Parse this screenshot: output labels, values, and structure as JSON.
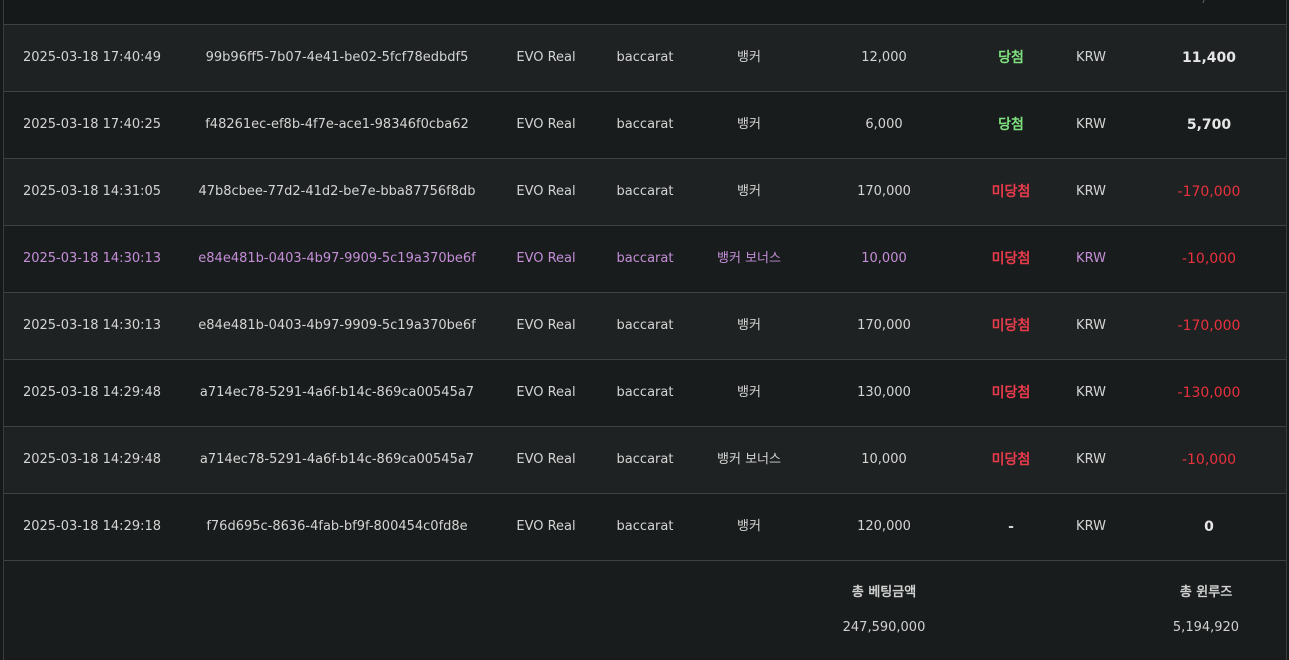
{
  "rows": [
    {
      "time": "2025-03-18 17:40:49",
      "id": "99b96ff5-7b07-4e41-be02-5fcf78edbdf5",
      "vendor": "EVO Real",
      "game": "baccarat",
      "pick": "뱅커",
      "amount": "12,000",
      "result": "당첨",
      "result_type": "win",
      "currency": "KRW",
      "winloss": "11,400",
      "winloss_type": "pos"
    },
    {
      "time": "2025-03-18 17:40:25",
      "id": "f48261ec-ef8b-4f7e-ace1-98346f0cba62",
      "vendor": "EVO Real",
      "game": "baccarat",
      "pick": "뱅커",
      "amount": "6,000",
      "result": "당첨",
      "result_type": "win",
      "currency": "KRW",
      "winloss": "5,700",
      "winloss_type": "pos"
    },
    {
      "time": "2025-03-18 14:31:05",
      "id": "47b8cbee-77d2-41d2-be7e-bba87756f8db",
      "vendor": "EVO Real",
      "game": "baccarat",
      "pick": "뱅커",
      "amount": "170,000",
      "result": "미당첨",
      "result_type": "lose",
      "currency": "KRW",
      "winloss": "-170,000",
      "winloss_type": "neg"
    },
    {
      "time": "2025-03-18 14:30:13",
      "id": "e84e481b-0403-4b97-9909-5c19a370be6f",
      "vendor": "EVO Real",
      "game": "baccarat",
      "pick": "뱅커 보너스",
      "amount": "10,000",
      "result": "미당첨",
      "result_type": "lose",
      "currency": "KRW",
      "winloss": "-10,000",
      "winloss_type": "neg",
      "highlight": true
    },
    {
      "time": "2025-03-18 14:30:13",
      "id": "e84e481b-0403-4b97-9909-5c19a370be6f",
      "vendor": "EVO Real",
      "game": "baccarat",
      "pick": "뱅커",
      "amount": "170,000",
      "result": "미당첨",
      "result_type": "lose",
      "currency": "KRW",
      "winloss": "-170,000",
      "winloss_type": "neg"
    },
    {
      "time": "2025-03-18 14:29:48",
      "id": "a714ec78-5291-4a6f-b14c-869ca00545a7",
      "vendor": "EVO Real",
      "game": "baccarat",
      "pick": "뱅커",
      "amount": "130,000",
      "result": "미당첨",
      "result_type": "lose",
      "currency": "KRW",
      "winloss": "-130,000",
      "winloss_type": "neg"
    },
    {
      "time": "2025-03-18 14:29:48",
      "id": "a714ec78-5291-4a6f-b14c-869ca00545a7",
      "vendor": "EVO Real",
      "game": "baccarat",
      "pick": "뱅커 보너스",
      "amount": "10,000",
      "result": "미당첨",
      "result_type": "lose",
      "currency": "KRW",
      "winloss": "-10,000",
      "winloss_type": "neg"
    },
    {
      "time": "2025-03-18 14:29:18",
      "id": "f76d695c-8636-4fab-bf9f-800454c0fd8e",
      "vendor": "EVO Real",
      "game": "baccarat",
      "pick": "뱅커",
      "amount": "120,000",
      "result": "-",
      "result_type": "neutral",
      "currency": "KRW",
      "winloss": "0",
      "winloss_type": "zero"
    }
  ],
  "footer": {
    "total_bet_label": "총 베팅금액",
    "total_bet_value": "247,590,000",
    "total_winloss_label": "총 윈루즈",
    "total_winloss_value": "5,194,920"
  },
  "colors": {
    "win": "#7ee07e",
    "lose": "#e83b4b",
    "highlight": "#c48ed8",
    "background": "#161919"
  }
}
